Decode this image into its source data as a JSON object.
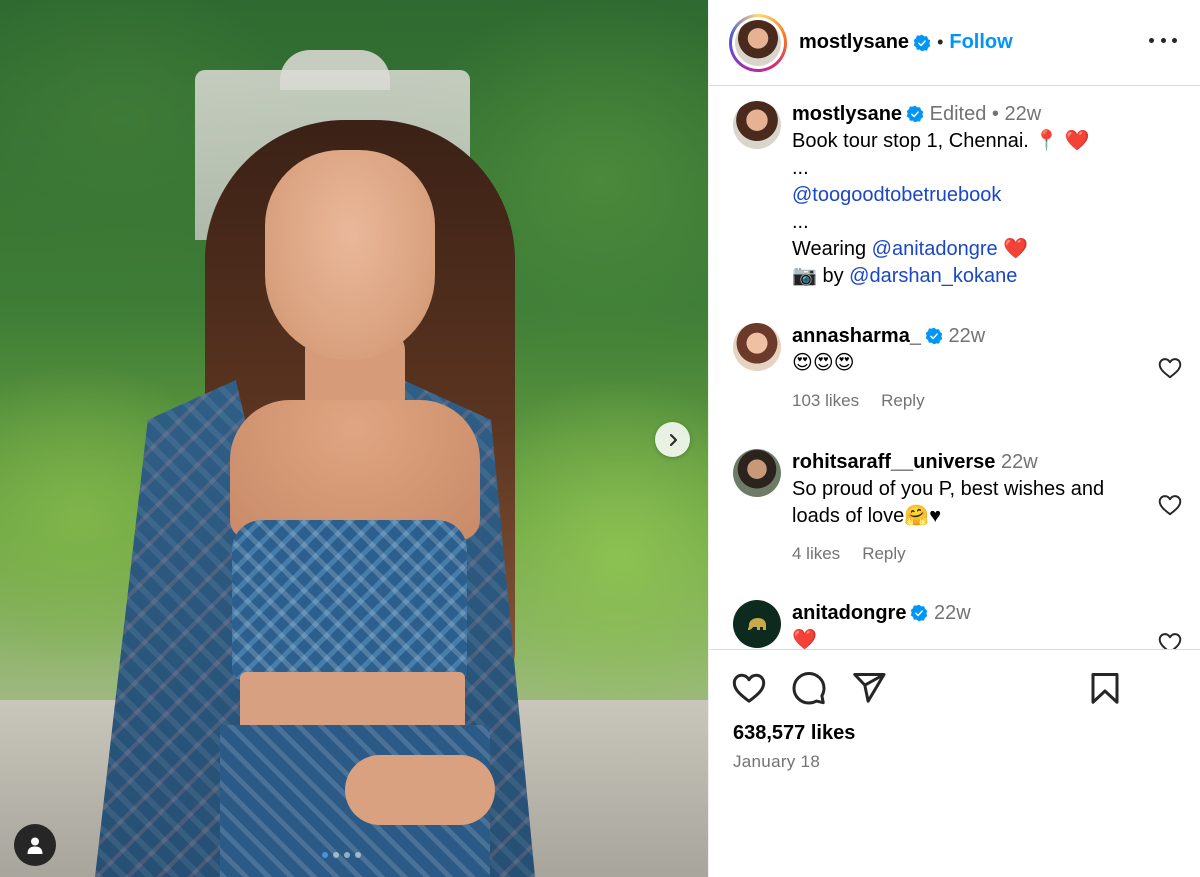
{
  "post": {
    "username": "mostlysane",
    "follow_label": "Follow",
    "separator": "•"
  },
  "caption": {
    "username": "mostlysane",
    "edited": "Edited",
    "dot": "•",
    "time": "22w",
    "line1": "Book tour stop 1, Chennai. 📍 ❤️",
    "line2": "...",
    "mention1": "@toogoodtobetruebook",
    "line3": "...",
    "wearing": "Wearing ",
    "mention2": "@anitadongre",
    "wearing_emoji": " ❤️",
    "camera_emoji": "📷",
    "by": " by ",
    "mention3": "@darshan_kokane"
  },
  "comments": [
    {
      "username": "annasharma_",
      "time": "22w",
      "text": "😍😍😍",
      "likes": "103 likes",
      "reply": "Reply",
      "verified": true
    },
    {
      "username": "rohitsaraff__universe",
      "time": "22w",
      "text": "So proud of you P, best wishes and loads of love🤗♥",
      "likes": "4 likes",
      "reply": "Reply",
      "verified": false
    },
    {
      "username": "anitadongre",
      "time": "22w",
      "text": "❤️",
      "verified": true
    }
  ],
  "stats": {
    "likes": "638,577 likes",
    "date": "January 18"
  },
  "carousel": {
    "count": 4,
    "active_index": 0
  },
  "colors": {
    "verified_blue": "#0095f6",
    "follow_blue": "#0095f6",
    "mention_blue": "#1a47c7",
    "heart_red": "#ed4956"
  },
  "icons": [
    "chevron-right-icon",
    "user-tag-icon",
    "more-icon",
    "verified-icon",
    "heart-icon",
    "comment-icon",
    "share-icon",
    "bookmark-icon"
  ]
}
